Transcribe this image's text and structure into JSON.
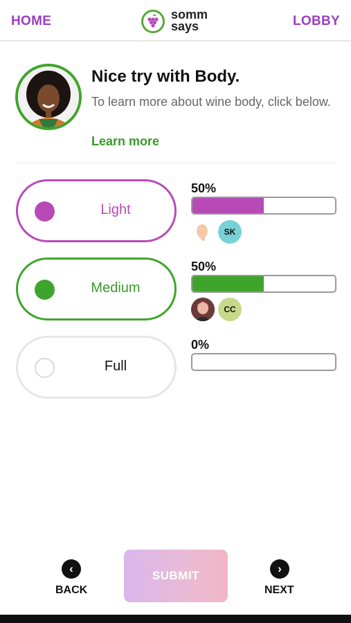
{
  "header": {
    "home_label": "HOME",
    "lobby_label": "LOBBY",
    "logo_line1": "somm",
    "logo_line2": "says"
  },
  "feedback": {
    "title": "Nice try with Body.",
    "body": "To learn more about wine body, click below.",
    "link": "Learn more"
  },
  "options": [
    {
      "label": "Light",
      "percent_text": "50%",
      "percent": 50,
      "color": "#b84ab8",
      "voters": [
        "",
        "SK"
      ]
    },
    {
      "label": "Medium",
      "percent_text": "50%",
      "percent": 50,
      "color": "#3fa42b",
      "voters": [
        "",
        "CC"
      ]
    },
    {
      "label": "Full",
      "percent_text": "0%",
      "percent": 0,
      "color": "#d9d9d9",
      "voters": []
    }
  ],
  "voter_colors": {
    "sk": "#77d1d6",
    "cc": "#c7d98a"
  },
  "nav": {
    "back_label": "BACK",
    "next_label": "NEXT",
    "submit_label": "SUBMIT"
  },
  "icons": {
    "back": "chevron-left-icon",
    "next": "chevron-right-icon",
    "logo": "grape-icon"
  }
}
